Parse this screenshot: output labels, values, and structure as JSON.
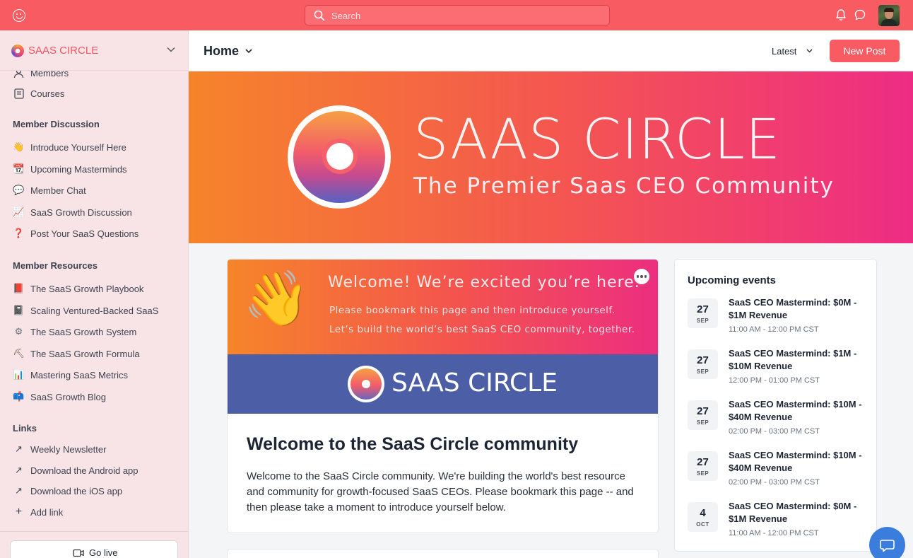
{
  "topbar": {
    "search_placeholder": "Search"
  },
  "sidebar": {
    "community_name": "SAAS CIRCLE",
    "top_items": [
      {
        "label": "Members",
        "icon": "members-icon"
      },
      {
        "label": "Courses",
        "icon": "courses-icon"
      }
    ],
    "sections": [
      {
        "heading": "Member Discussion",
        "items": [
          {
            "label": "Introduce Yourself Here",
            "emoji": "👋"
          },
          {
            "label": "Upcoming Masterminds",
            "emoji": "📆"
          },
          {
            "label": "Member Chat",
            "emoji": "💬"
          },
          {
            "label": "SaaS Growth Discussion",
            "emoji": "📈"
          },
          {
            "label": "Post Your SaaS Questions",
            "emoji": "❓"
          }
        ]
      },
      {
        "heading": "Member Resources",
        "items": [
          {
            "label": "The SaaS Growth Playbook",
            "emoji": "📕"
          },
          {
            "label": "Scaling Ventured-Backed SaaS",
            "emoji": "📓"
          },
          {
            "label": "The SaaS Growth System",
            "emoji": "⚙"
          },
          {
            "label": "The SaaS Growth Formula",
            "emoji": "⛏"
          },
          {
            "label": "Mastering SaaS Metrics",
            "emoji": "📊"
          },
          {
            "label": "SaaS Growth Blog",
            "emoji": "📫"
          }
        ]
      },
      {
        "heading": "Links",
        "items": [
          {
            "label": "Weekly Newsletter",
            "emoji": "↗"
          },
          {
            "label": "Download the Android app",
            "emoji": "↗"
          },
          {
            "label": "Download the iOS app",
            "emoji": "↗"
          },
          {
            "label": "Add link",
            "emoji": "+"
          }
        ]
      }
    ],
    "go_live_label": "Go live"
  },
  "header": {
    "title": "Home",
    "sort_label": "Latest",
    "new_post_label": "New Post"
  },
  "banner": {
    "title": "SAAS CIRCLE",
    "subtitle": "The Premier Saas CEO Community"
  },
  "post": {
    "welcome_title": "Welcome! We’re excited you’re here.",
    "welcome_line1": "Please bookmark this page and then introduce yourself.",
    "welcome_line2": "Let’s build the world’s best SaaS CEO community, together.",
    "brand_name": "SAAS CIRCLE",
    "title": "Welcome to the SaaS Circle community",
    "body": "Welcome to the SaaS Circle community. We're building the world's best resource and community for growth-focused SaaS CEOs. Please bookmark this page -- and then please take a moment to introduce yourself below."
  },
  "events": {
    "heading": "Upcoming events",
    "items": [
      {
        "day": "27",
        "month": "SEP",
        "title": "SaaS CEO Mastermind: $0M - $1M Revenue",
        "time": "11:00 AM - 12:00 PM CST"
      },
      {
        "day": "27",
        "month": "SEP",
        "title": "SaaS CEO Mastermind: $1M - $10M Revenue",
        "time": "12:00 PM - 01:00 PM CST"
      },
      {
        "day": "27",
        "month": "SEP",
        "title": "SaaS CEO Mastermind: $10M - $40M Revenue",
        "time": "02:00 PM - 03:00 PM CST"
      },
      {
        "day": "27",
        "month": "SEP",
        "title": "SaaS CEO Mastermind: $10M - $40M Revenue",
        "time": "02:00 PM - 03:00 PM CST"
      },
      {
        "day": "4",
        "month": "OCT",
        "title": "SaaS CEO Mastermind: $0M - $1M Revenue",
        "time": "11:00 AM - 12:00 PM CST"
      }
    ]
  },
  "colors": {
    "brand": "#f95b62",
    "sidebar_bg": "#f8e4e6",
    "brandbar_bg": "#4c5fa6",
    "fab": "#3b7ddd"
  }
}
